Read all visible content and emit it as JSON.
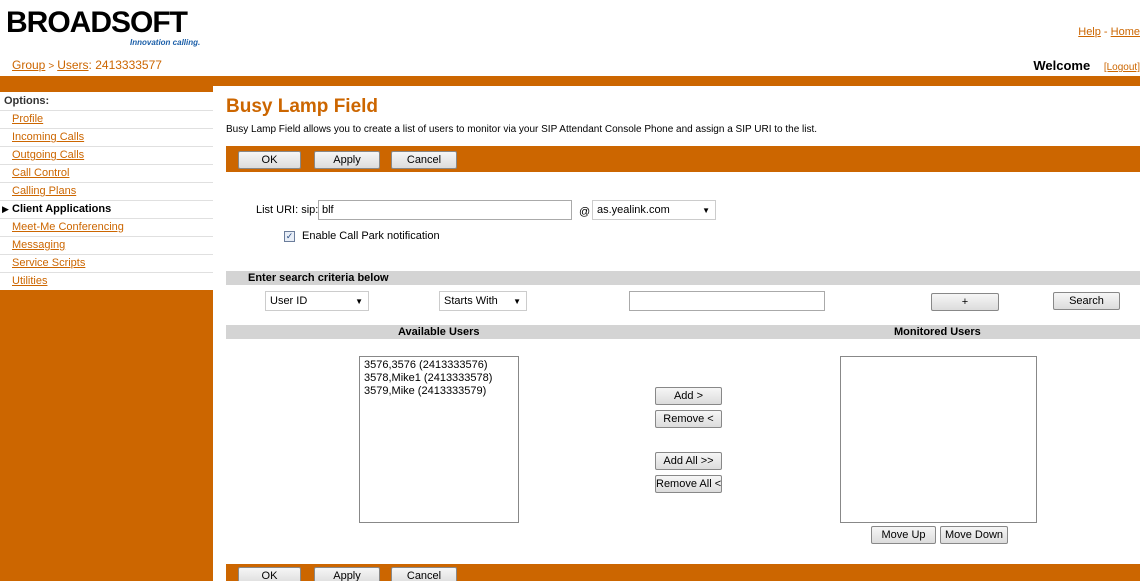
{
  "header": {
    "logo_text": "BROADSOFT",
    "logo_tagline": "Innovation calling.",
    "help_label": "Help",
    "home_label": "Home",
    "link_separator": " - ",
    "welcome_label": "Welcome",
    "logout_label": "[Logout]"
  },
  "breadcrumb": {
    "group": "Group",
    "sep": ">",
    "users": "Users",
    "user_id": ": 2413333577"
  },
  "sidebar": {
    "title": "Options:",
    "items": [
      {
        "label": "Profile"
      },
      {
        "label": "Incoming Calls"
      },
      {
        "label": "Outgoing Calls"
      },
      {
        "label": "Call Control"
      },
      {
        "label": "Calling Plans"
      },
      {
        "label": "Client Applications"
      },
      {
        "label": "Meet-Me Conferencing"
      },
      {
        "label": "Messaging"
      },
      {
        "label": "Service Scripts"
      },
      {
        "label": "Utilities"
      }
    ],
    "active_index": 5
  },
  "page": {
    "title": "Busy Lamp Field",
    "description": "Busy Lamp Field allows you to create a list of users to monitor via your SIP Attendant Console Phone and assign a SIP URI to the list."
  },
  "buttons": {
    "ok": "OK",
    "apply": "Apply",
    "cancel": "Cancel",
    "plus": "+",
    "search": "Search",
    "add": "Add >",
    "remove": "Remove <",
    "add_all": "Add All >>",
    "remove_all": "Remove All <<",
    "move_up": "Move Up",
    "move_down": "Move Down"
  },
  "form": {
    "list_uri_label": "List URI: sip:",
    "list_uri_value": "blf",
    "at_sign": "@",
    "domain_value": "as.yealink.com",
    "call_park_label": "Enable Call Park notification",
    "call_park_checked": true
  },
  "search": {
    "header": "Enter search criteria below",
    "field_value": "User ID",
    "mode_value": "Starts With",
    "text_value": ""
  },
  "users": {
    "available_header": "Available Users",
    "monitored_header": "Monitored Users",
    "available": [
      "3576,3576 (2413333576)",
      "3578,Mike1 (2413333578)",
      "3579,Mike (2413333579)"
    ],
    "monitored": []
  },
  "colors": {
    "accent": "#cc6600",
    "section_bar": "#d4d4d4"
  }
}
